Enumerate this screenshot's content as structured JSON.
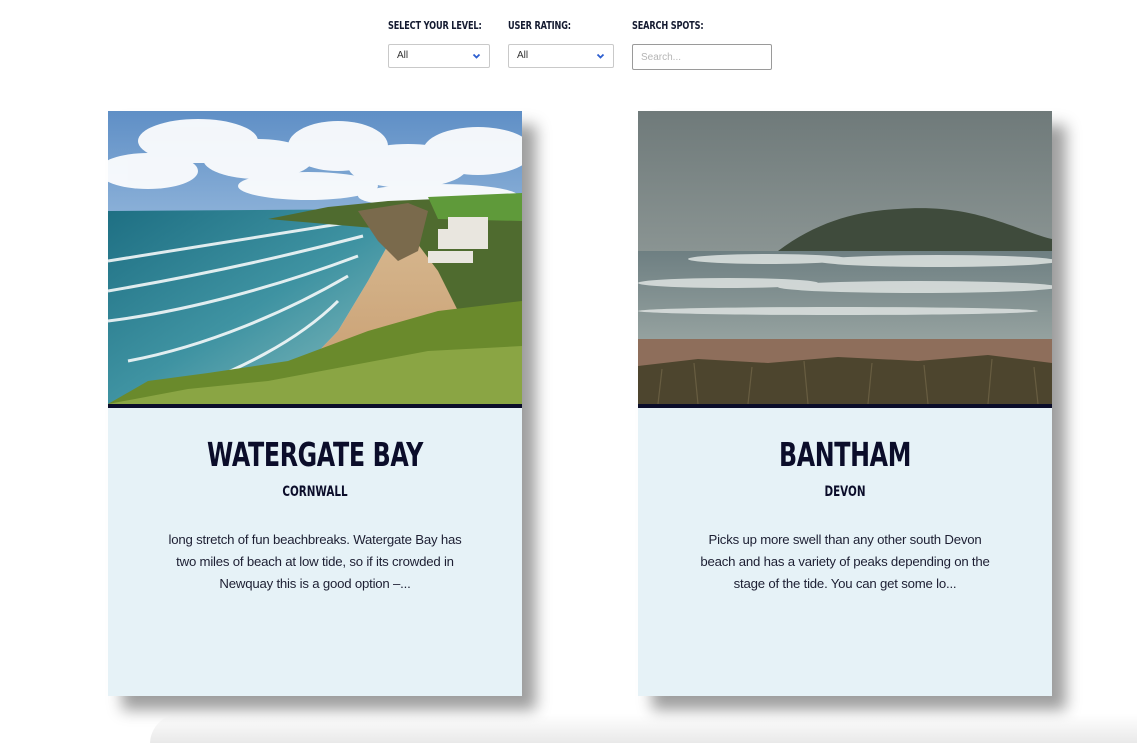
{
  "filters": {
    "level": {
      "label": "Select your level:",
      "value": "All"
    },
    "rating": {
      "label": "User rating:",
      "value": "All"
    },
    "search": {
      "label": "Search spots:",
      "placeholder": "Search..."
    }
  },
  "icons": {
    "dropdown": "chevron-down-icon"
  },
  "colors": {
    "navy": "#0b0d2a",
    "card_bg": "#e6f2f7",
    "chevron": "#2d5fd0"
  },
  "spots": [
    {
      "title": "Watergate Bay",
      "region": "Cornwall",
      "description": "long stretch of fun beachbreaks. Watergate Bay has two miles of beach at low tide, so if its crowded in Newquay this is a good option –..."
    },
    {
      "title": "Bantham",
      "region": "Devon",
      "description": "Picks up more swell than any other south Devon beach and has a variety of peaks depending on the stage of the tide. You can get some lo..."
    }
  ]
}
